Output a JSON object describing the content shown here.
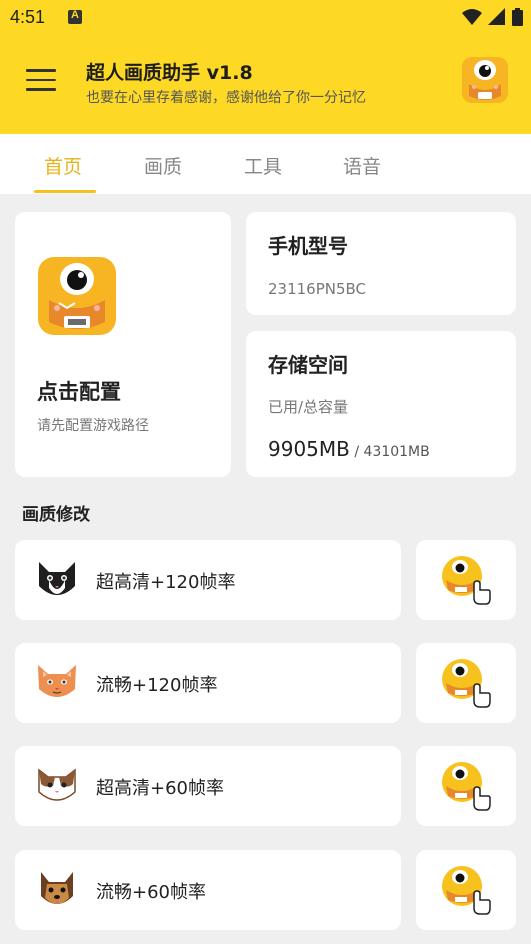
{
  "status": {
    "time": "4:51",
    "a_icon": "text-a-icon",
    "wifi_icon": "wifi-icon",
    "signal_icon": "signal-icon",
    "battery_icon": "battery-icon"
  },
  "header": {
    "menu_icon": "hamburger-menu-icon",
    "title": "超人画质助手 v1.8",
    "subtitle": "也要在心里存着感谢，感谢他给了你一分记忆",
    "logo_icon": "monster-logo-icon"
  },
  "tabs": [
    {
      "label": "首页",
      "active": true
    },
    {
      "label": "画质",
      "active": false
    },
    {
      "label": "工具",
      "active": false
    },
    {
      "label": "语音",
      "active": false
    }
  ],
  "config": {
    "title": "点击配置",
    "subtitle": "请先配置游戏路径",
    "icon": "monster-logo-icon"
  },
  "phone": {
    "title": "手机型号",
    "value": "23116PN5BC"
  },
  "storage": {
    "title": "存储空间",
    "label": "已用/总容量",
    "used": "9905MB",
    "separator": " / ",
    "total": "43101MB"
  },
  "section": {
    "title": "画质修改"
  },
  "items": [
    {
      "label": "超高清+120帧率",
      "icon": "black-white-cat-icon",
      "button_icon": "tap-monster-icon"
    },
    {
      "label": "流畅+120帧率",
      "icon": "orange-cat-icon",
      "button_icon": "tap-monster-icon"
    },
    {
      "label": "超高清+60帧率",
      "icon": "brown-cat-icon",
      "button_icon": "tap-monster-icon"
    },
    {
      "label": "流畅+60帧率",
      "icon": "yorkie-dog-icon",
      "button_icon": "tap-monster-icon"
    }
  ],
  "colors": {
    "accent": "#fdd925",
    "tab_active": "#e7b31a",
    "background": "#efefef"
  }
}
